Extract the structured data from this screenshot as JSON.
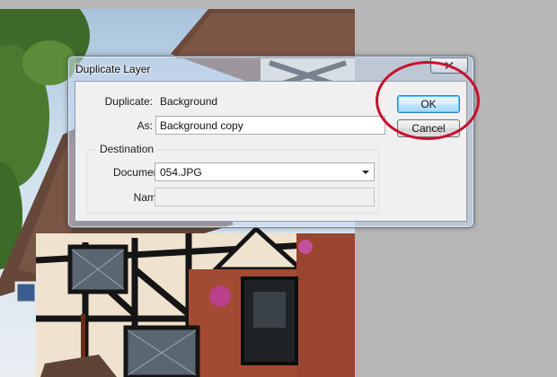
{
  "dialog": {
    "title": "Duplicate Layer",
    "duplicate_label": "Duplicate:",
    "duplicate_value": "Background",
    "as_label": "As:",
    "as_value": "Background copy",
    "destination": {
      "legend": "Destination",
      "document_label": "Document:",
      "document_value": "054.JPG",
      "name_label": "Name:",
      "name_value": ""
    },
    "ok_label": "OK",
    "cancel_label": "Cancel"
  },
  "icons": {
    "close": "close-icon",
    "dropdown": "chevron-down-icon"
  },
  "colors": {
    "highlight_ring": "#c8102e",
    "default_button": "#3c7fb1"
  }
}
